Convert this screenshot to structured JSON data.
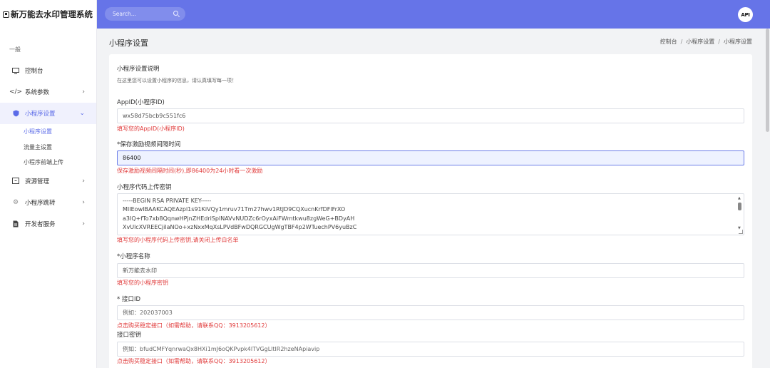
{
  "app": {
    "title": "新万能去水印管理系统"
  },
  "topbar": {
    "search_placeholder": "Search...",
    "api_logo": "API"
  },
  "sidebar": {
    "section_label": "一般",
    "items": [
      {
        "label": "控制台",
        "icon": "monitor-icon"
      },
      {
        "label": "系统参数",
        "icon": "code-icon"
      },
      {
        "label": "小程序设置",
        "icon": "shield-icon"
      },
      {
        "label": "资源管理",
        "icon": "box-icon"
      },
      {
        "label": "小程序跳转",
        "icon": "gear-icon"
      },
      {
        "label": "开发者服务",
        "icon": "file-icon"
      }
    ],
    "sub_items": [
      "小程序设置",
      "流量主设置",
      "小程序前端上传"
    ]
  },
  "page": {
    "title": "小程序设置",
    "breadcrumb": [
      "控制台",
      "小程序设置",
      "小程序设置"
    ]
  },
  "form": {
    "card_title": "小程序设置说明",
    "card_desc": "在这里您可以设置小程序的信息，请认真填写每一项！",
    "appid": {
      "label": "AppID(小程序ID)",
      "value": "wx58d75bcb9c551fc6",
      "hint": "填写您的AppID(小程序ID)"
    },
    "interval": {
      "label": "*保存激励视频间隔时间",
      "value": "86400",
      "hint": "保存激励视频间隔时间(秒),即86400为24小时看一次激励"
    },
    "upload_key": {
      "label": "小程序代码上传密钥",
      "lines": [
        "-----BEGIN RSA PRIVATE KEY-----",
        "MIIEowIBAAKCAQEAzpl1s91KiVQy1mruv71Tm27hwv1RtJD9CQXucnKrfDFlFrXO",
        "a3IQ+fTo7xb8QqnwHPjnZHEdriSplNAVvNUDZc6rOyxAiFWmtkwu8zgWeG+BDyAH",
        "XvUlcXVREECjilaNOo+xzNxxMqXsLPVdBFwDQRGCUgWgTBF4p2WTuechPV6yuBzC"
      ],
      "hint": "填写您的小程序代码上传密钥,请关闭上传白名单"
    },
    "app_name": {
      "label": "*小程序名称",
      "value": "新万能去水印",
      "hint": "填写您的小程序密钥"
    },
    "api_id": {
      "label": "* 接口ID",
      "placeholder": "例如：202037003",
      "hint": "点击购买稳定接口（如需帮助，请联系QQ：3913205612）"
    },
    "api_secret": {
      "label": "接口密钥",
      "placeholder": "例如：bfudCMFYqnrwaQx8HXi1mJ6oQKPvpk4lTVGgLltlR2hzeNApiavip",
      "hint": "点击购买稳定接口（如需帮助，请联系QQ：3913205612）"
    }
  },
  "colors": {
    "accent": "#6674e8",
    "error": "#e03a3a"
  }
}
